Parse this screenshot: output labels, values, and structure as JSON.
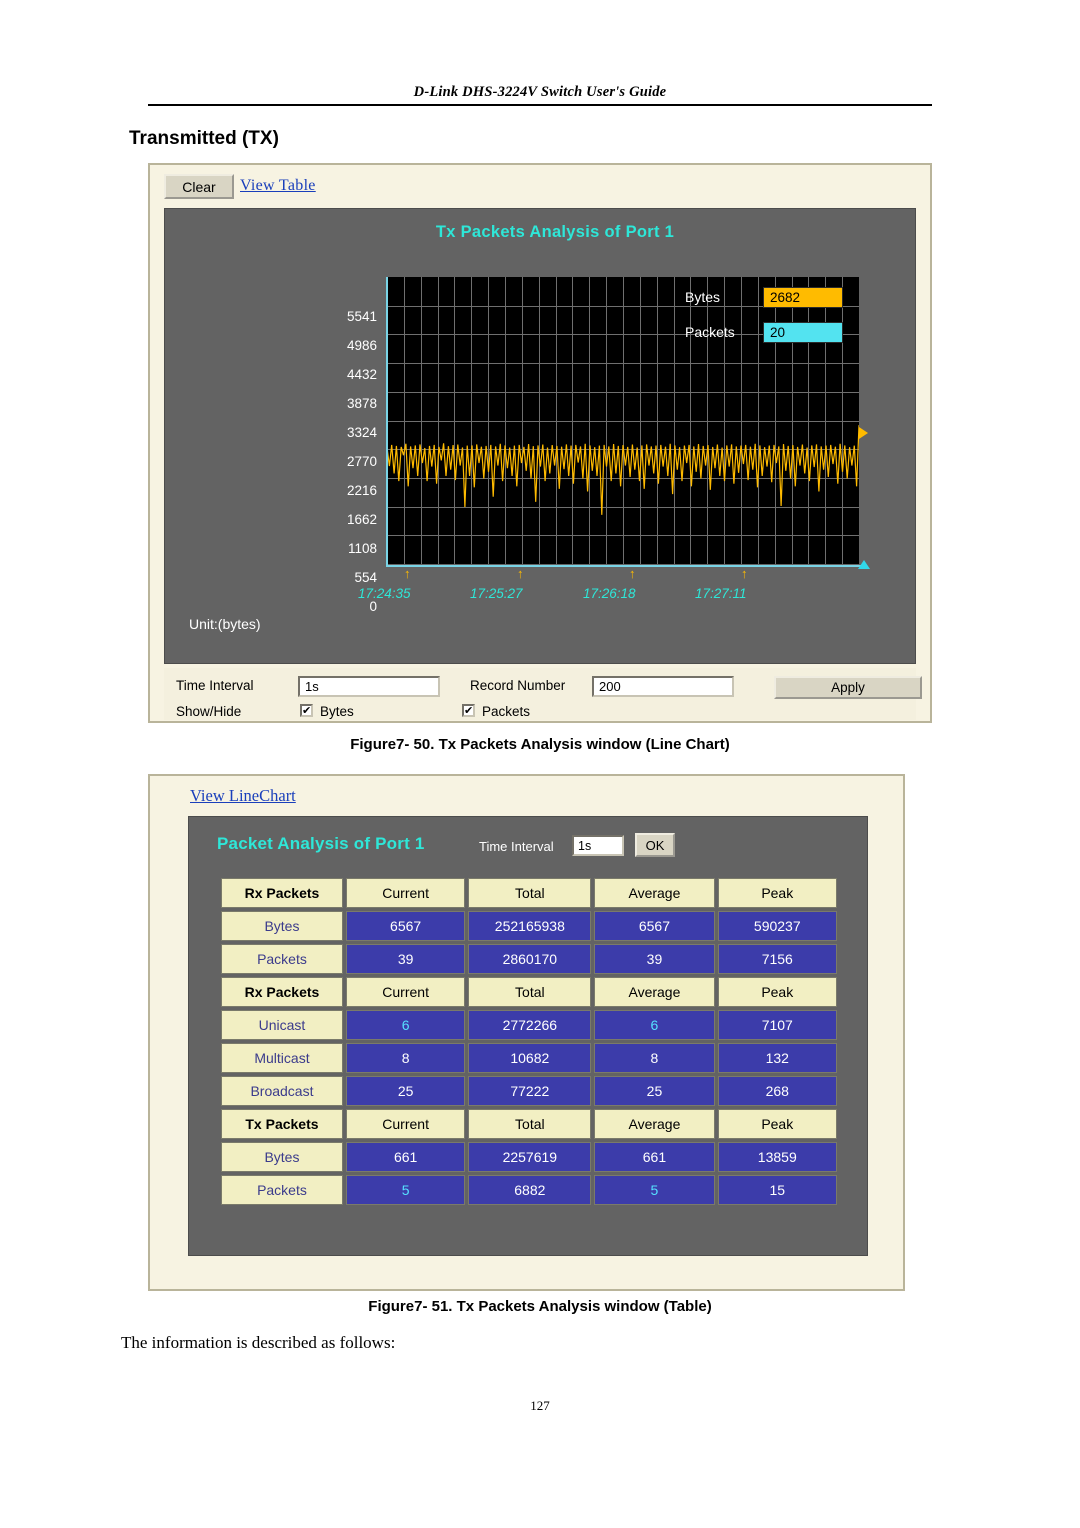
{
  "header": {
    "title": "D-Link DHS-3224V Switch User's Guide"
  },
  "section": {
    "title": "Transmitted (TX)"
  },
  "figure1": {
    "toolbar": {
      "clear_label": "Clear",
      "view_table_link": "View Table"
    },
    "chart_title": "Tx Packets Analysis of Port 1",
    "unit_label": "Unit:(bytes)",
    "legend": [
      {
        "name": "Bytes",
        "value": "2682",
        "color": "#ffbb00"
      },
      {
        "name": "Packets",
        "value": "20",
        "color": "#53e3f0"
      }
    ],
    "controls": {
      "time_interval_label": "Time Interval",
      "time_interval_value": "1s",
      "record_number_label": "Record Number",
      "record_number_value": "200",
      "apply_label": "Apply",
      "show_hide_label": "Show/Hide",
      "bytes_label": "Bytes",
      "bytes_checked": "✔",
      "packets_label": "Packets",
      "packets_checked": "✔"
    },
    "caption": "Figure7- 50.  Tx Packets Analysis window (Line Chart)"
  },
  "chart_data": {
    "type": "line",
    "title": "Tx Packets Analysis of Port 1",
    "xlabel": "",
    "ylabel": "Unit:(bytes)",
    "ylim": [
      0,
      5541
    ],
    "yticks": [
      "5541",
      "4986",
      "4432",
      "3878",
      "3324",
      "2770",
      "2216",
      "1662",
      "1108",
      "554",
      "0"
    ],
    "xticks": [
      "17:24:35",
      "17:25:27",
      "17:26:18",
      "17:27:11"
    ],
    "grid": true,
    "legend_position": "right",
    "series": [
      {
        "name": "Bytes",
        "color": "#ffbb00",
        "current": 2682,
        "values": [
          2250,
          1890,
          2300,
          1750,
          2280,
          1600,
          2260,
          2100,
          2320,
          1500,
          2270,
          1850,
          2290,
          1700,
          2310,
          1950,
          2240,
          1600,
          2280,
          1880,
          2300,
          1550,
          2260,
          2000,
          2330,
          1700,
          2275,
          1820,
          2295,
          1620,
          2305,
          1900,
          2250,
          1100,
          2285,
          1700,
          2290,
          1480,
          2310,
          1950,
          2265,
          1650,
          2280,
          1780,
          2300,
          1300,
          2270,
          1900,
          2320,
          1600,
          2290,
          1850,
          2250,
          1700,
          2285,
          1500,
          2300,
          1950,
          2260,
          1800,
          2315,
          1650,
          2275,
          1200,
          2290,
          1880,
          2305,
          1600,
          2250,
          1750,
          2295,
          1900,
          2280,
          1450,
          2265,
          1830,
          2310,
          1700,
          2285,
          1550,
          2300,
          1960,
          2270,
          1650,
          2320,
          1400,
          2290,
          1800,
          2255,
          1700,
          2285,
          950,
          2300,
          1880,
          2270,
          1600,
          2315,
          1750,
          2280,
          1500,
          2295,
          1900,
          2260,
          1680,
          2305,
          1820,
          2250,
          1600,
          2290,
          1450,
          2310,
          1900,
          2270,
          1750,
          2285,
          1550,
          2300,
          1880,
          2265,
          1700,
          2320,
          1350,
          2290,
          1820,
          2255,
          1600,
          2285,
          1950,
          2300,
          1500,
          2270,
          1780,
          2315,
          1650,
          2280,
          1900,
          2295,
          1430,
          2260,
          1850,
          2305,
          1700,
          2250,
          1600,
          2290,
          1880,
          2310,
          1550,
          2270,
          1760,
          2285,
          1930,
          2300,
          1620,
          2265,
          1820,
          2320,
          1480,
          2290,
          1700,
          2255,
          1880,
          2285,
          1580,
          2300,
          1950,
          2270,
          1120,
          2315,
          1800,
          2280,
          1650,
          2295,
          1500,
          2260,
          1900,
          2305,
          1750,
          2250,
          1600,
          2290,
          1870,
          2310,
          1400,
          2270,
          1820,
          2285,
          1680,
          2300,
          1930,
          2265,
          1550,
          2320,
          1780,
          2290,
          1650,
          2255,
          1900,
          2285,
          1500,
          2682
        ]
      },
      {
        "name": "Packets",
        "color": "#53e3f0",
        "current": 20,
        "values": []
      }
    ]
  },
  "figure2": {
    "view_linechart_link": "View LineChart",
    "panel_title": "Packet Analysis of Port 1",
    "time_interval_label": "Time Interval",
    "time_interval_value": "1s",
    "ok_label": "OK",
    "caption": "Figure7- 51.  Tx Packets Analysis window (Table)",
    "tables": [
      {
        "header": [
          "Rx Packets",
          "Current",
          "Total",
          "Average",
          "Peak"
        ],
        "rows": [
          {
            "label": "Bytes",
            "values": [
              "6567",
              "252165938",
              "6567",
              "590237"
            ],
            "highlight": [
              false,
              false,
              false,
              false
            ]
          },
          {
            "label": "Packets",
            "values": [
              "39",
              "2860170",
              "39",
              "7156"
            ],
            "highlight": [
              false,
              false,
              false,
              false
            ]
          }
        ]
      },
      {
        "header": [
          "Rx Packets",
          "Current",
          "Total",
          "Average",
          "Peak"
        ],
        "rows": [
          {
            "label": "Unicast",
            "values": [
              "6",
              "2772266",
              "6",
              "7107"
            ],
            "highlight": [
              true,
              false,
              true,
              false
            ]
          },
          {
            "label": "Multicast",
            "values": [
              "8",
              "10682",
              "8",
              "132"
            ],
            "highlight": [
              false,
              false,
              false,
              false
            ]
          },
          {
            "label": "Broadcast",
            "values": [
              "25",
              "77222",
              "25",
              "268"
            ],
            "highlight": [
              false,
              false,
              false,
              false
            ]
          }
        ]
      },
      {
        "header": [
          "Tx Packets",
          "Current",
          "Total",
          "Average",
          "Peak"
        ],
        "rows": [
          {
            "label": "Bytes",
            "values": [
              "661",
              "2257619",
              "661",
              "13859"
            ],
            "highlight": [
              false,
              false,
              false,
              false
            ]
          },
          {
            "label": "Packets",
            "values": [
              "5",
              "6882",
              "5",
              "15"
            ],
            "highlight": [
              true,
              false,
              true,
              false
            ]
          }
        ]
      }
    ]
  },
  "body": {
    "text": "The information is described as follows:"
  },
  "page_number": "127"
}
